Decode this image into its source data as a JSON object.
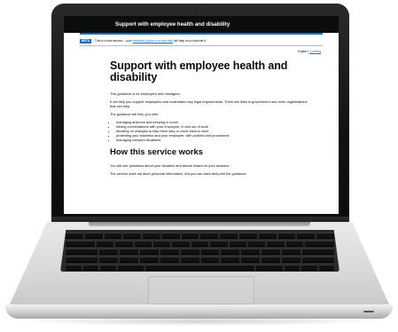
{
  "site": {
    "service_name": "Support with employee health and disability",
    "phase_tag": "BETA",
    "phase_text": "This is a new service – your",
    "phase_link": "feedback (opens in a new tab)",
    "phase_text_after": "will help us to improve it.",
    "language_current": "English",
    "language_link": "Cymraeg"
  },
  "page": {
    "title": "Support with employee health and disability",
    "intro": "This guidance is for employers and managers.",
    "help_text": "It will help you support employees and understand any legal requirements. There are links to government and other organisations that can help.",
    "list_intro": "The guidance will help you with:",
    "list_items": [
      "managing absence and keeping in touch",
      "having conversations with your employee, in and out of work",
      "deciding on changes to help them stay or come back to work",
      "protecting your business and your employee, with policies and procedures",
      "managing complex situations"
    ],
    "section_heading": "How this service works",
    "section_p1": "You will see questions about your situation and advice based on your answers.",
    "section_p2": "The service does not store personal information, but you can save and print the guidance."
  }
}
